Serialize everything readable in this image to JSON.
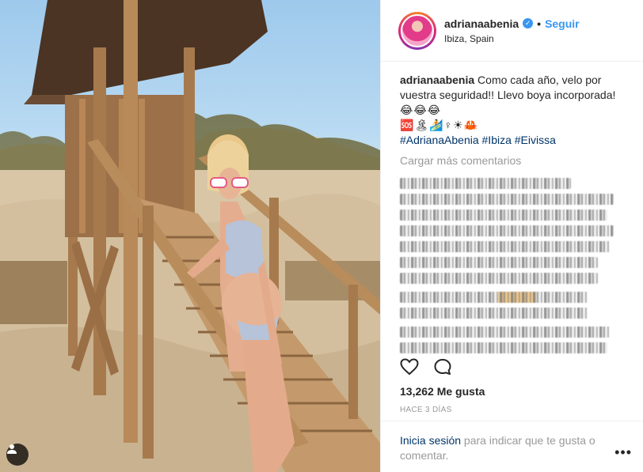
{
  "post": {
    "header": {
      "username": "adrianaabenia",
      "separator": "•",
      "follow_label": "Seguir",
      "location": "Ibiza, Spain",
      "verified_icon": "verified-badge-icon"
    },
    "caption": {
      "username": "adrianaabenia",
      "text": "Como cada año, velo por vuestra seguridad!! Llevo boya incorporada!",
      "emoji_line_1": "😂😂😂",
      "emoji_line_2": "🆘🏝🏄♀☀🦀",
      "hashtags": "#AdrianaAbenia #Ibiza #Eivissa"
    },
    "load_more": "Cargar más comentarios",
    "actions": {
      "like_icon": "heart-icon",
      "comment_icon": "comment-icon"
    },
    "likes": "13,262 Me gusta",
    "timestamp": "HACE 3 DÍAS",
    "login_prompt": {
      "link": "Inicia sesión",
      "text": " para indicar que te gusta o comentar."
    },
    "more_label": "•••",
    "colors": {
      "link_blue": "#3897f0",
      "hashtag_navy": "#003569",
      "muted_gray": "#999999"
    }
  }
}
